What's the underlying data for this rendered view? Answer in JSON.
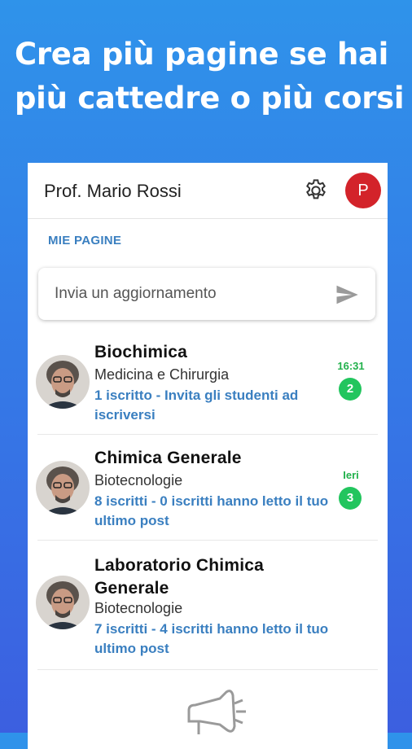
{
  "headline": "Crea più pagine se hai più cattedre o più corsi",
  "appbar": {
    "title": "Prof. Mario Rossi",
    "avatar_letter": "P"
  },
  "section_label": "MIE PAGINE",
  "compose": {
    "placeholder": "Invia un aggiornamento"
  },
  "pages": [
    {
      "name": "Biochimica",
      "subtitle": "Medicina e Chirurgia",
      "info": "1 iscritto - Invita gli studenti ad iscriversi",
      "time": "16:31",
      "badge": "2"
    },
    {
      "name": "Chimica Generale",
      "subtitle": "Biotecnologie",
      "info": "8 iscritti - 0 iscritti hanno letto il tuo ultimo post",
      "time": "Ieri",
      "badge": "3"
    },
    {
      "name": "Laboratorio Chimica Generale",
      "subtitle": "Biotecnologie",
      "info": "7 iscritti - 4 iscritti hanno letto il tuo ultimo post"
    }
  ],
  "colors": {
    "accent": "#3a7fc0",
    "badge": "#22c55e",
    "avatar": "#d3232a"
  },
  "icons": [
    "gear-icon",
    "send-icon",
    "megaphone-icon"
  ]
}
